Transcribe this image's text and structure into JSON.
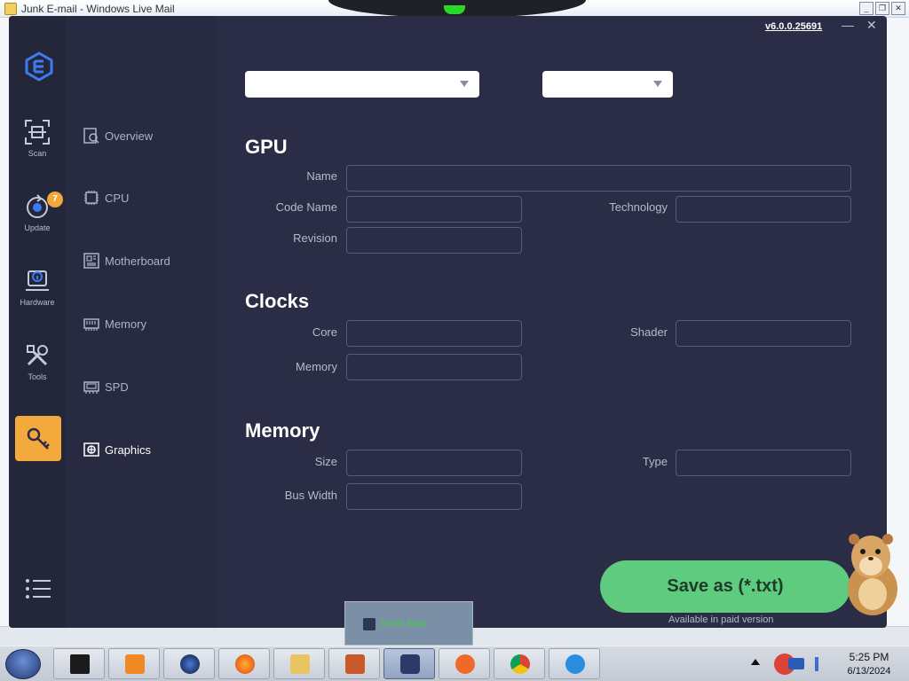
{
  "background_window": {
    "title": "Junk E-mail - Windows Live Mail"
  },
  "app": {
    "version": "v6.0.0.25691",
    "rail": [
      {
        "label": "Scan",
        "icon": "scan-icon"
      },
      {
        "label": "Update",
        "icon": "update-icon",
        "badge": "7"
      },
      {
        "label": "Hardware",
        "icon": "hardware-info-icon"
      },
      {
        "label": "Tools",
        "icon": "tools-icon"
      },
      {
        "label": "",
        "icon": "key-icon"
      }
    ],
    "subnav": [
      {
        "label": "Overview",
        "icon": "overview-icon"
      },
      {
        "label": "CPU",
        "icon": "cpu-icon"
      },
      {
        "label": "Motherboard",
        "icon": "motherboard-icon"
      },
      {
        "label": "Memory",
        "icon": "memory-icon"
      },
      {
        "label": "SPD",
        "icon": "spd-icon"
      },
      {
        "label": "Graphics",
        "icon": "graphics-icon",
        "active": true
      }
    ],
    "dropdowns": {
      "device": "",
      "sub": ""
    },
    "gpu": {
      "title": "GPU",
      "fields": {
        "name": "Name",
        "code_name": "Code Name",
        "technology": "Technology",
        "revision": "Revision"
      }
    },
    "clocks": {
      "title": "Clocks",
      "fields": {
        "core": "Core",
        "shader": "Shader",
        "memory": "Memory"
      }
    },
    "memory": {
      "title": "Memory",
      "fields": {
        "size": "Size",
        "type": "Type",
        "bus_width": "Bus Width"
      }
    },
    "save_button": "Save as (*.txt)",
    "paid_note": "Available in paid version"
  },
  "taskbar_preview": {
    "label": "Driver Easy"
  },
  "taskbar": {
    "time": "5:25 PM",
    "date": "6/13/2024"
  },
  "colors": {
    "app_bg": "#2a2d45",
    "accent_orange": "#f4a93c",
    "save_green": "#5ecb7e"
  }
}
